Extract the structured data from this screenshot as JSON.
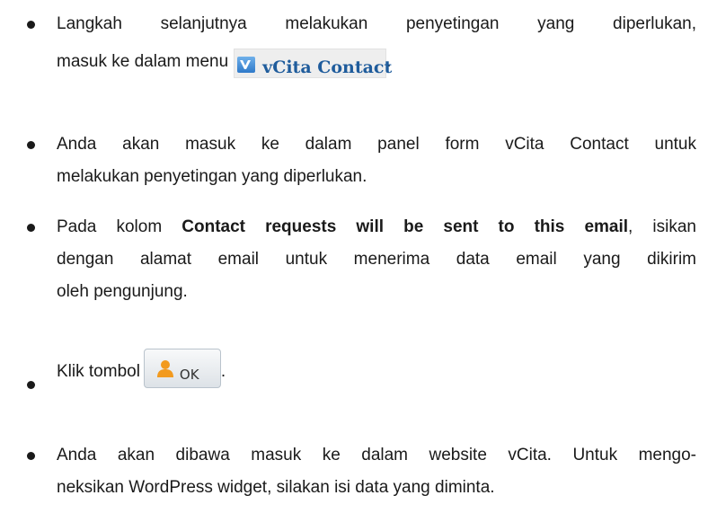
{
  "items": [
    {
      "line1": "Langkah selanjutnya melakukan penyetingan yang diperlukan,",
      "line2_prefix": "masuk ke dalam menu",
      "menu_label": "vCita Contact",
      "suffix": "."
    },
    {
      "line1": "Anda akan masuk ke dalam panel form vCita Contact untuk",
      "line2": "melakukan penyetingan yang diperlukan."
    },
    {
      "line1_prefix": "Pada kolom",
      "line1_bold": "Contact requests will be sent to this email",
      "line1_suffix": ", isikan",
      "line2": "dengan alamat email untuk menerima data email yang dikirim",
      "line3": "oleh pengunjung."
    },
    {
      "prefix": "Klik tombol",
      "button_label": "OK",
      "suffix": "."
    },
    {
      "line1": "Anda akan dibawa masuk ke dalam website vCita. Untuk mengo-",
      "line2": "neksikan WordPress widget, silakan isi data yang diminta."
    }
  ]
}
